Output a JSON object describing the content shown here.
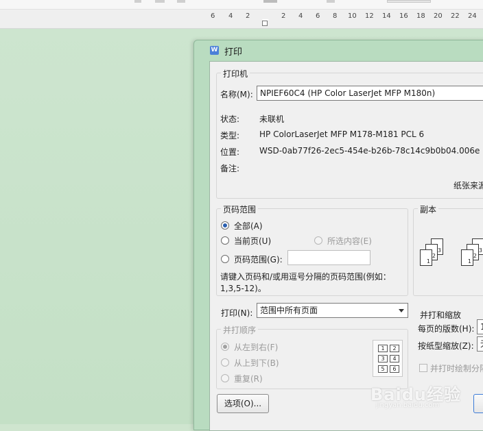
{
  "ruler": {
    "ticks": [
      "6",
      "4",
      "2",
      "2",
      "4",
      "6",
      "8",
      "10",
      "12",
      "14",
      "16",
      "18",
      "20",
      "22",
      "24"
    ]
  },
  "dialog": {
    "title": "打印",
    "app_icon": "wps-writer-icon",
    "printer": {
      "group": "打印机",
      "name_label": "名称(M):",
      "name_value": "NPIEF60C4 (HP Color LaserJet MFP M180n)",
      "status_label": "状态:",
      "status_value": "未联机",
      "type_label": "类型:",
      "type_value": "HP ColorLaserJet MFP M178-M181 PCL 6",
      "location_label": "位置:",
      "location_value": "WSD-0ab77f26-2ec5-454e-b26b-78c14c9b0b04.006e",
      "comment_label": "备注:",
      "paper_source": "纸张来源"
    },
    "page_range": {
      "group": "页码范围",
      "all": "全部(A)",
      "current": "当前页(U)",
      "selection": "所选内容(E)",
      "pages": "页码范围(G):",
      "pages_value": "",
      "hint_line1": "请键入页码和/或用逗号分隔的页码范围(例如：",
      "hint_line2": "1,3,5-12)。"
    },
    "copies": {
      "group": "副本"
    },
    "print_what": {
      "label": "打印(N):",
      "value": "范围中所有页面"
    },
    "collate_order": {
      "group": "并打顺序",
      "left_to_right": "从左到右(F)",
      "top_to_bottom": "从上到下(B)",
      "repeat": "重复(R)",
      "cells": [
        "1",
        "2",
        "3",
        "4",
        "5",
        "6"
      ]
    },
    "zoom": {
      "group": "并打和缩放",
      "pages_per_sheet_label": "每页的版数(H):",
      "pages_per_sheet_value": "1",
      "scale_label": "按纸型缩放(Z):",
      "scale_value": "无",
      "draw_borders": "并打时绘制分隔线"
    },
    "options_button": "选项(O)..."
  },
  "watermark": {
    "main": "Baidu经验",
    "sub": "jingyan.baidu.com"
  }
}
